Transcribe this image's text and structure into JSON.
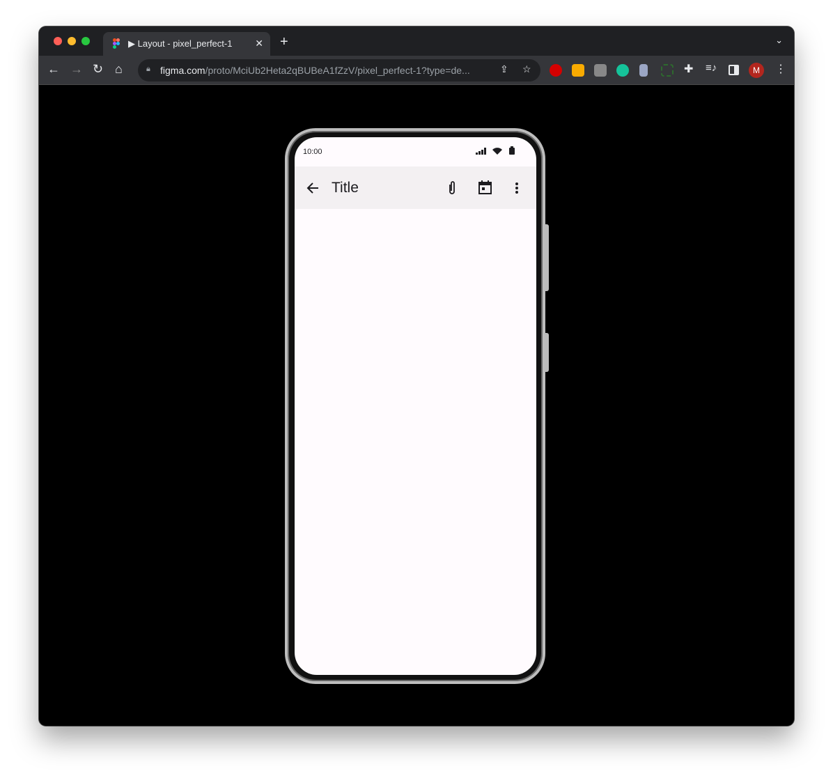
{
  "browser": {
    "tab_title": "▶ Layout - pixel_perfect-1",
    "url_host": "figma.com",
    "url_path": "/proto/MciUb2Heta2qBUBeA1fZzV/pixel_perfect-1?type=de...",
    "profile_initial": "M"
  },
  "phone": {
    "status_time": "10:00",
    "app_title": "Title"
  }
}
